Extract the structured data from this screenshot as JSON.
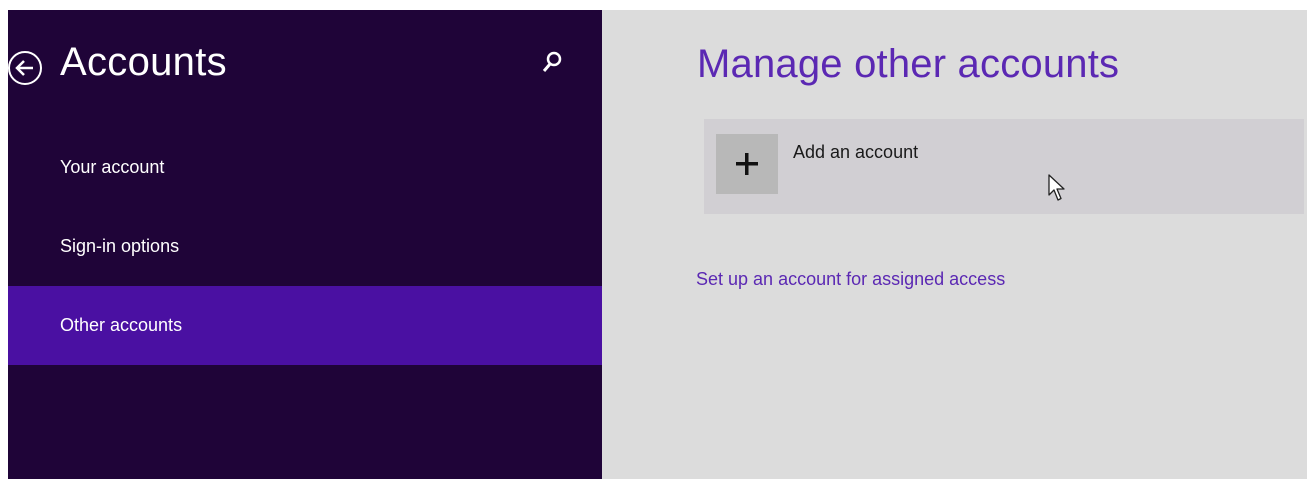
{
  "sidebar": {
    "title": "Accounts",
    "items": [
      {
        "label": "Your account"
      },
      {
        "label": "Sign-in options"
      },
      {
        "label": "Other accounts"
      }
    ],
    "active_index": 2
  },
  "main": {
    "title": "Manage other accounts",
    "add_account_label": "Add an account",
    "assigned_access_link": "Set up an account for assigned access"
  },
  "icons": {
    "back": "back-arrow-icon",
    "search": "search-icon",
    "add": "plus-icon",
    "cursor": "mouse-pointer-icon"
  },
  "colors": {
    "sidebar_bg": "#1f0438",
    "active_item_bg": "#4a10a2",
    "main_bg": "#dcdcdc",
    "accent_text": "#5b28b3"
  }
}
